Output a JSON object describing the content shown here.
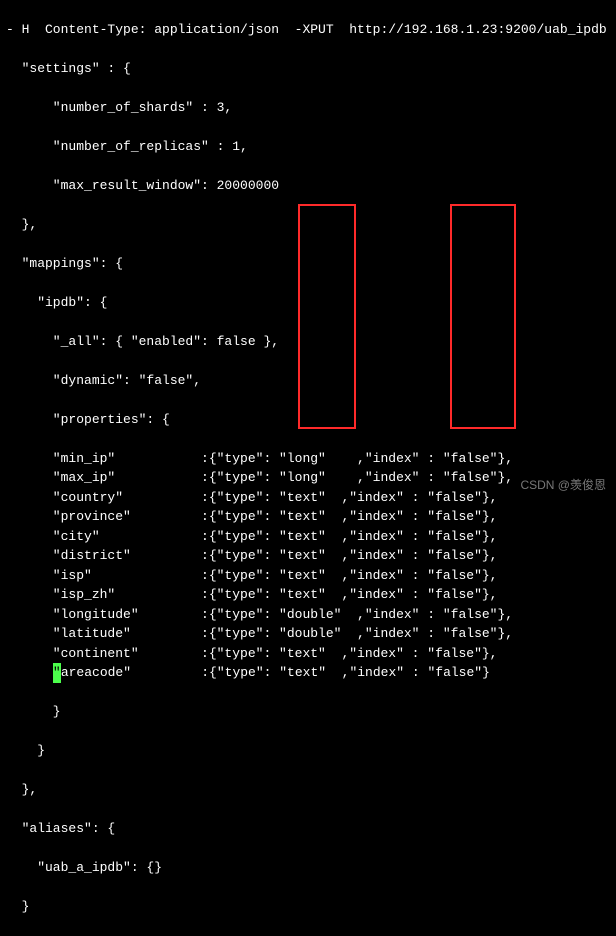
{
  "header_fragment": "- H  Content-Type: application/json  -XPUT  http://192.168.1.23:9200/uab_ipdb",
  "settings_open": "  \"settings\" : {",
  "settings_shards": "      \"number_of_shards\" : 3,",
  "settings_replicas": "      \"number_of_replicas\" : 1,",
  "settings_mrw": "      \"max_result_window\": 20000000",
  "close_brace_comma": "  },",
  "mappings_open": "  \"mappings\": {",
  "ipdb_open": "    \"ipdb\": {",
  "all_line": "      \"_all\": { \"enabled\": false },",
  "dynamic_line": "      \"dynamic\": \"false\",",
  "properties_open": "      \"properties\": {",
  "props": [
    {
      "key": "min_ip",
      "type": "long",
      "index": "false",
      "pad_key": "\"min_ip\"           ",
      "val": ":{\"type\": \"long\"    ,\"index\" : \"false\"},"
    },
    {
      "key": "max_ip",
      "type": "long",
      "index": "false",
      "pad_key": "\"max_ip\"           ",
      "val": ":{\"type\": \"long\"    ,\"index\" : \"false\"},"
    },
    {
      "key": "country",
      "type": "text",
      "index": "false",
      "pad_key": "\"country\"          ",
      "val": ":{\"type\": \"text\"  ,\"index\" : \"false\"},"
    },
    {
      "key": "province",
      "type": "text",
      "index": "false",
      "pad_key": "\"province\"         ",
      "val": ":{\"type\": \"text\"  ,\"index\" : \"false\"},"
    },
    {
      "key": "city",
      "type": "text",
      "index": "false",
      "pad_key": "\"city\"             ",
      "val": ":{\"type\": \"text\"  ,\"index\" : \"false\"},"
    },
    {
      "key": "district",
      "type": "text",
      "index": "false",
      "pad_key": "\"district\"         ",
      "val": ":{\"type\": \"text\"  ,\"index\" : \"false\"},"
    },
    {
      "key": "isp",
      "type": "text",
      "index": "false",
      "pad_key": "\"isp\"              ",
      "val": ":{\"type\": \"text\"  ,\"index\" : \"false\"},"
    },
    {
      "key": "isp_zh",
      "type": "text",
      "index": "false",
      "pad_key": "\"isp_zh\"           ",
      "val": ":{\"type\": \"text\"  ,\"index\" : \"false\"},"
    },
    {
      "key": "longitude",
      "type": "double",
      "index": "false",
      "pad_key": "\"longitude\"        ",
      "val": ":{\"type\": \"double\"  ,\"index\" : \"false\"},"
    },
    {
      "key": "latitude",
      "type": "double",
      "index": "false",
      "pad_key": "\"latitude\"         ",
      "val": ":{\"type\": \"double\"  ,\"index\" : \"false\"},"
    },
    {
      "key": "continent",
      "type": "text",
      "index": "false",
      "pad_key": "\"continent\"        ",
      "val": ":{\"type\": \"text\"  ,\"index\" : \"false\"},"
    },
    {
      "key": "areacode",
      "type": "text",
      "index": "false",
      "pad_key": "areacode\"         ",
      "val": ":{\"type\": \"text\"  ,\"index\" : \"false\"}",
      "cursor": true
    }
  ],
  "close_inner": "      }",
  "close_ipdb": "    }",
  "aliases_open": "  \"aliases\": {",
  "aliases_entry": "    \"uab_a_ipdb\": {}",
  "close_aliases": "  }",
  "watermark": "CSDN @羡俊恩"
}
